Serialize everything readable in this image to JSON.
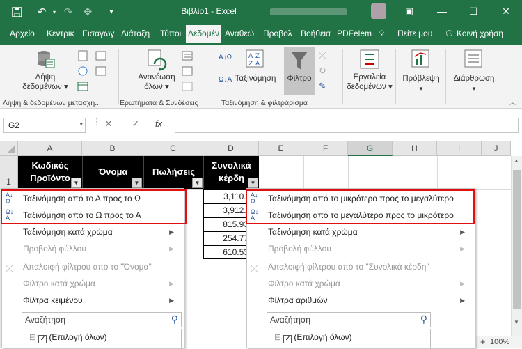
{
  "titlebar": {
    "title": "Βιβλίο1  -  Excel",
    "save_icon": "save-icon",
    "undo_icon": "undo-icon",
    "redo_icon": "redo-icon",
    "minimize": "—",
    "maximize": "☐",
    "close": "✕",
    "ribbon_display_icon": "ribbon-display-icon"
  },
  "tabs": {
    "file": "Αρχείο",
    "home": "Κεντρικ",
    "insert": "Εισαγωγ",
    "layout": "Διάταξη",
    "formulas": "Τύποι",
    "data": "Δεδομέν",
    "review": "Αναθεώ",
    "view": "Προβολ",
    "help": "Βοήθεια",
    "pdf": "PDFelem",
    "tell_me": "Πείτε μου",
    "share": "Κοινή χρήση"
  },
  "ribbon": {
    "get_data_line1": "Λήψη",
    "get_data_line2": "δεδομένων ▾",
    "group1": "Λήψη & δεδομένων μετασχη...",
    "refresh_line1": "Ανανέωση",
    "refresh_line2": "όλων ▾",
    "group2": "Ερωτήματα & Συνδέσεις",
    "sort_az_icon": "Α↓Ω",
    "sort_za_icon": "Ω↓Α",
    "sort": "Ταξινόμηση",
    "filter": "Φίλτρο",
    "group3": "Ταξινόμηση & φιλτράρισμα",
    "data_tools_line1": "Εργαλεία",
    "data_tools_line2": "δεδομένων ▾",
    "forecast": "Πρόβλεψη",
    "outline": "Διάρθρωση"
  },
  "formula_bar": {
    "name_box": "G2",
    "cancel": "✕",
    "enter": "✓",
    "fx": "fx",
    "content": ""
  },
  "grid": {
    "columns": [
      "A",
      "B",
      "C",
      "D",
      "E",
      "F",
      "G",
      "H",
      "I",
      "J"
    ],
    "row1": "1",
    "headers": {
      "a_line1": "Κωδικός",
      "a_line2": "Προϊόντο",
      "b": "Όνομα",
      "c": "Πωλήσεις",
      "d_line1": "Συνολικά",
      "d_line2": "κέρδη"
    },
    "d_values": [
      "3,110.00",
      "3,912.68",
      "815.93 €",
      "254.77 €",
      "610.53 €"
    ]
  },
  "menu_left": {
    "sort_asc": "Ταξινόμηση από το Α προς το Ω",
    "sort_desc": "Ταξινόμηση από το Ω προς το Α",
    "sort_color": "Ταξινόμηση κατά χρώμα",
    "sheet_view": "Προβολή φύλλου",
    "clear_filter": "Απαλοιφή φίλτρου από το \"Όνομα\"",
    "filter_color": "Φίλτρο κατά χρώμα",
    "text_filters": "Φίλτρα κειμένου",
    "search_placeholder": "Αναζήτηση",
    "select_all": "(Επιλογή όλων)"
  },
  "menu_right": {
    "sort_asc": "Ταξινόμηση από το μικρότερο προς το μεγαλύτερο",
    "sort_desc": "Ταξινόμηση από το μεγαλύτερο προς το μικρότερο",
    "sort_color": "Ταξινόμηση κατά χρώμα",
    "sheet_view": "Προβολή φύλλου",
    "clear_filter": "Απαλοιφή φίλτρου από το \"Συνολικά κέρδη\"",
    "filter_color": "Φίλτρο κατά χρώμα",
    "number_filters": "Φίλτρα αριθμών",
    "search_placeholder": "Αναζήτηση",
    "select_all": "(Επιλογή όλων)"
  },
  "status": {
    "zoom": "100%"
  },
  "colors": {
    "accent": "#217346",
    "highlight": "#e01010"
  }
}
